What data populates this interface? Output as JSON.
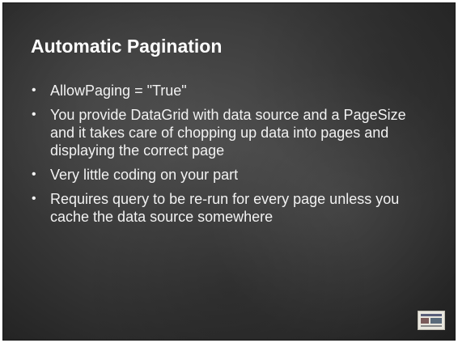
{
  "slide": {
    "title": "Automatic Pagination",
    "bullets": [
      "AllowPaging = \"True\"",
      "You provide DataGrid with data source and a PageSize and it takes care of chopping up data into pages and displaying the correct page",
      "Very little coding on your part",
      "Requires query to be re-run for every page unless you cache the data source somewhere"
    ],
    "bullet_glyph": "•",
    "logo_icon": "aspnet-logo-icon"
  }
}
